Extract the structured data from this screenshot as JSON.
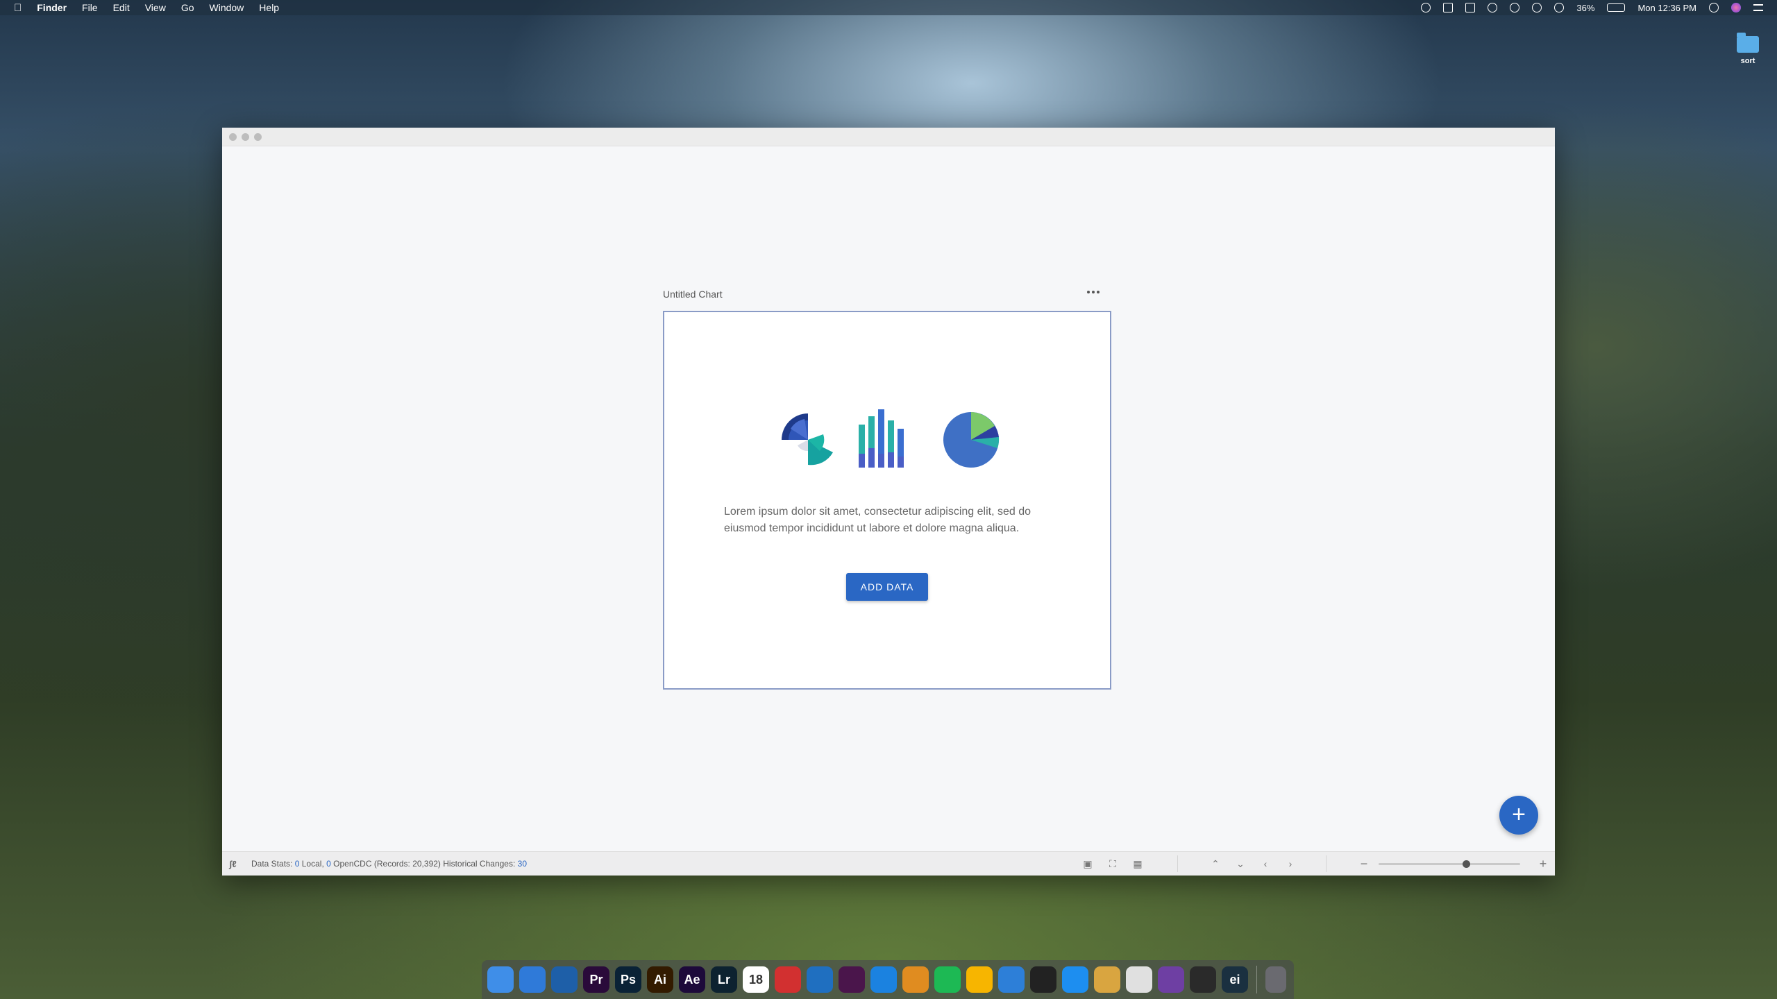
{
  "menubar": {
    "apple": "",
    "app": "Finder",
    "items": [
      "File",
      "Edit",
      "View",
      "Go",
      "Window",
      "Help"
    ],
    "battery": "36%",
    "clock": "Mon 12:36 PM"
  },
  "desktop": {
    "folder_label": "sort"
  },
  "app": {
    "chart_title": "Untitled Chart",
    "body_text": "Lorem ipsum dolor sit amet, consectetur adipiscing elit, sed do eiusmod tempor incididunt ut labore et dolore magna aliqua.",
    "add_data_label": "ADD DATA",
    "fab_label": "+",
    "accent": "#2a67c4"
  },
  "status": {
    "prefix": "Data Stats:",
    "local_count": "0",
    "local_label": "Local,",
    "opencdc_count": "0",
    "opencdc_label": "OpenCDC",
    "records": "(Records: 20,392)",
    "hist_label": "Historical Changes:",
    "hist_count": "30",
    "zoom_fraction": 0.62
  },
  "dock": {
    "apps": [
      {
        "name": "finder-icon",
        "label": "",
        "bg": "#3f8ee8"
      },
      {
        "name": "navigation-icon",
        "label": "",
        "bg": "#2f7ad9"
      },
      {
        "name": "1password-icon",
        "label": "",
        "bg": "#1e5fa8"
      },
      {
        "name": "premiere-icon",
        "label": "Pr",
        "bg": "#2a0a3a"
      },
      {
        "name": "photoshop-icon",
        "label": "Ps",
        "bg": "#0a2236"
      },
      {
        "name": "illustrator-icon",
        "label": "Ai",
        "bg": "#331b00"
      },
      {
        "name": "after-effects-icon",
        "label": "Ae",
        "bg": "#1d0a3a"
      },
      {
        "name": "lightroom-icon",
        "label": "Lr",
        "bg": "#0d2230"
      },
      {
        "name": "calendar-icon",
        "label": "18",
        "bg": "#ffffff"
      },
      {
        "name": "bird-app-icon",
        "label": "",
        "bg": "#d23030"
      },
      {
        "name": "vscode-icon",
        "label": "",
        "bg": "#1f6fc0"
      },
      {
        "name": "slack-icon",
        "label": "",
        "bg": "#4a154b"
      },
      {
        "name": "safari-icon",
        "label": "",
        "bg": "#1b82e0"
      },
      {
        "name": "transmit-icon",
        "label": "",
        "bg": "#e08c20"
      },
      {
        "name": "spotify-icon",
        "label": "",
        "bg": "#1db954"
      },
      {
        "name": "sketch-icon",
        "label": "",
        "bg": "#f7b500"
      },
      {
        "name": "charts-app-icon",
        "label": "",
        "bg": "#2d7fd8"
      },
      {
        "name": "terminal-icon",
        "label": "",
        "bg": "#222222"
      },
      {
        "name": "framer-icon",
        "label": "",
        "bg": "#1d8ef0"
      },
      {
        "name": "cyberduck-icon",
        "label": "",
        "bg": "#d9a540"
      },
      {
        "name": "chrome-icon",
        "label": "",
        "bg": "#e0e0e0"
      },
      {
        "name": "github-icon",
        "label": "",
        "bg": "#6e3fa3"
      },
      {
        "name": "spark-icon",
        "label": "",
        "bg": "#2a2a2a"
      },
      {
        "name": "electron-app-icon",
        "label": "ei",
        "bg": "#1a3040"
      }
    ],
    "trash": {
      "name": "trash-icon",
      "label": "",
      "bg": "#6a6a70"
    }
  }
}
